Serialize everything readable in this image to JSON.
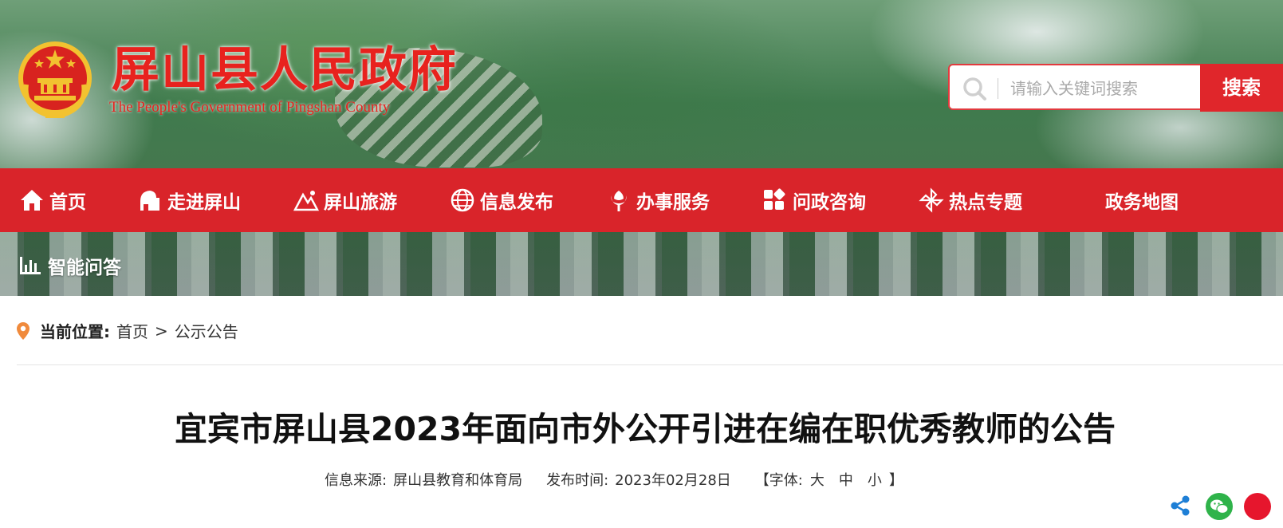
{
  "header": {
    "site_title": "屏山县人民政府",
    "site_subtitle": "The People's Government of Pingshan County"
  },
  "search": {
    "placeholder": "请输入关键词搜索",
    "button_label": "搜索"
  },
  "nav": {
    "items": [
      {
        "label": "首页",
        "icon": "home-icon"
      },
      {
        "label": "走进屏山",
        "icon": "landmark-icon"
      },
      {
        "label": "屏山旅游",
        "icon": "mountain-icon"
      },
      {
        "label": "信息发布",
        "icon": "globe-icon"
      },
      {
        "label": "办事服务",
        "icon": "flower-icon"
      },
      {
        "label": "问政咨询",
        "icon": "grid-icon"
      },
      {
        "label": "热点专题",
        "icon": "pinwheel-icon"
      },
      {
        "label": "政务地图",
        "icon": ""
      }
    ],
    "secondary": {
      "label": "智能问答",
      "icon": "bar-chart-icon"
    }
  },
  "breadcrumb": {
    "label": "当前位置:",
    "home": "首页",
    "separator": ">",
    "current": "公示公告"
  },
  "article": {
    "title": "宜宾市屏山县2023年面向市外公开引进在编在职优秀教师的公告",
    "source_label": "信息来源:",
    "source_value": "屏山县教育和体育局",
    "date_label": "发布时间:",
    "date_value": "2023年02月28日",
    "font_open": "【字体:",
    "font_large": "大",
    "font_medium": "中",
    "font_small": "小",
    "font_close": "】"
  },
  "colors": {
    "brand_red": "#d9242a",
    "search_border": "#e23a3e",
    "location_pin": "#f08a3c"
  }
}
